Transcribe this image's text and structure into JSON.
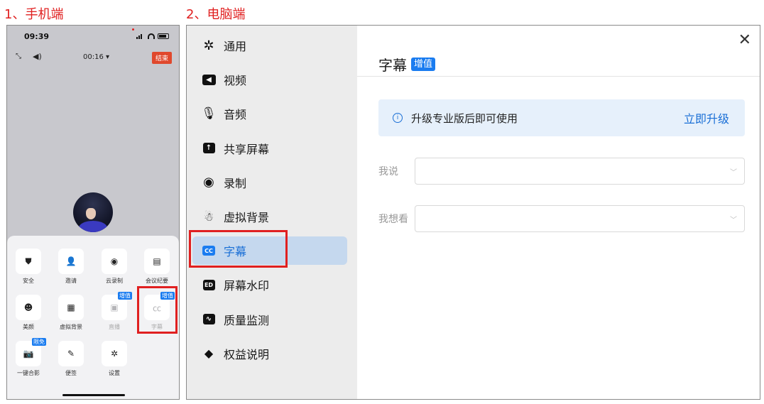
{
  "headings": {
    "mobile": "1、手机端",
    "desktop": "2、电脑端"
  },
  "phone": {
    "time": "09:39",
    "timer": "00:16 ▾",
    "end_label": "结束",
    "grid": [
      {
        "label": "安全",
        "icon": "shield-icon",
        "glyph": "⛊"
      },
      {
        "label": "邀请",
        "icon": "add-user-icon",
        "glyph": "👤"
      },
      {
        "label": "云录制",
        "icon": "record-icon",
        "glyph": "◉"
      },
      {
        "label": "会议纪要",
        "icon": "notes-icon",
        "glyph": "▤"
      },
      {
        "label": "美颜",
        "icon": "beauty-icon",
        "glyph": "☻"
      },
      {
        "label": "虚拟背景",
        "icon": "virtual-bg-icon",
        "glyph": "▦"
      },
      {
        "label": "直播",
        "icon": "live-icon",
        "glyph": "▣",
        "tag": "增值"
      },
      {
        "label": "字幕",
        "icon": "caption-icon",
        "glyph": "㏄",
        "tag": "增值"
      },
      {
        "label": "一键合影",
        "icon": "camera-icon",
        "glyph": "📷",
        "tag": "限免"
      },
      {
        "label": "便签",
        "icon": "memo-icon",
        "glyph": "✎"
      },
      {
        "label": "设置",
        "icon": "gear-icon",
        "glyph": "✲"
      }
    ]
  },
  "desktop": {
    "nav": [
      {
        "label": "通用",
        "icon": "gear-icon"
      },
      {
        "label": "视频",
        "icon": "video-icon"
      },
      {
        "label": "音频",
        "icon": "microphone-icon"
      },
      {
        "label": "共享屏幕",
        "icon": "share-screen-icon"
      },
      {
        "label": "录制",
        "icon": "record-icon"
      },
      {
        "label": "虚拟背景",
        "icon": "virtual-bg-icon"
      },
      {
        "label": "字幕",
        "icon": "caption-icon"
      },
      {
        "label": "屏幕水印",
        "icon": "watermark-icon"
      },
      {
        "label": "质量监测",
        "icon": "monitor-icon"
      },
      {
        "label": "权益说明",
        "icon": "diamond-icon"
      }
    ],
    "panel": {
      "title": "字幕",
      "badge": "增值",
      "notice": "升级专业版后即可使用",
      "upgrade_link": "立即升级",
      "field1_label": "我说",
      "field2_label": "我想看"
    }
  }
}
